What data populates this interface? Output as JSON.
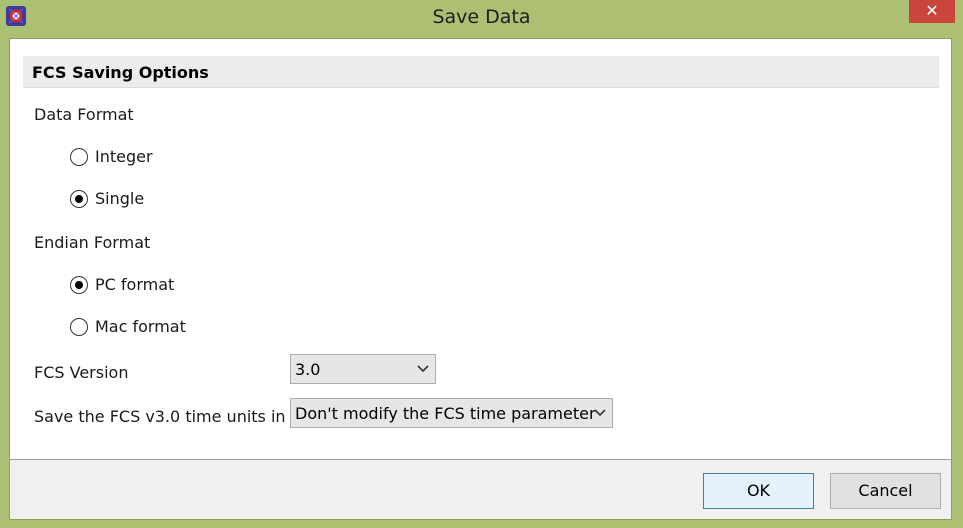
{
  "window": {
    "title": "Save Data",
    "close_symbol": "✕"
  },
  "section": {
    "title": "FCS Saving Options"
  },
  "data_format": {
    "label": "Data Format",
    "options": [
      {
        "label": "Integer",
        "selected": false
      },
      {
        "label": "Single",
        "selected": true
      }
    ]
  },
  "endian_format": {
    "label": "Endian Format",
    "options": [
      {
        "label": "PC format",
        "selected": true
      },
      {
        "label": "Mac format",
        "selected": false
      }
    ]
  },
  "fcs_version": {
    "label": "FCS Version",
    "value": "3.0"
  },
  "time_units": {
    "label": "Save the FCS v3.0 time units in",
    "value": "Don't modify the FCS time parameter"
  },
  "buttons": {
    "ok": "OK",
    "cancel": "Cancel"
  },
  "colors": {
    "title_bar": "#adbf72",
    "close_button": "#c9443a",
    "ok_border": "#3c7fb1"
  },
  "icons": {
    "app": "fcs-express-app-icon",
    "dropdown": "chevron-down-icon",
    "close": "close-icon"
  }
}
